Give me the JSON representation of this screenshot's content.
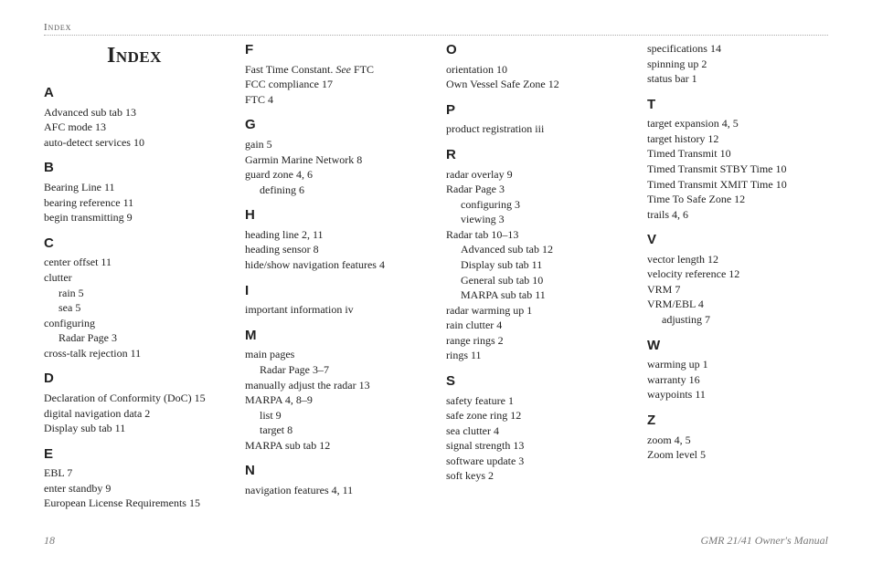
{
  "header_top": "Index",
  "title": "Index",
  "footer_left": "18",
  "footer_right": "GMR 21/41 Owner's Manual",
  "cols": [
    [
      {
        "type": "title"
      },
      {
        "type": "letter",
        "text": "A"
      },
      {
        "type": "entry",
        "text": "Advanced sub tab  13"
      },
      {
        "type": "entry",
        "text": "AFC mode  13"
      },
      {
        "type": "entry",
        "text": "auto-detect services  10"
      },
      {
        "type": "letter",
        "text": "B"
      },
      {
        "type": "entry",
        "text": "Bearing Line  11"
      },
      {
        "type": "entry",
        "text": "bearing reference  11"
      },
      {
        "type": "entry",
        "text": "begin transmitting  9"
      },
      {
        "type": "letter",
        "text": "C"
      },
      {
        "type": "entry",
        "text": "center offset  11"
      },
      {
        "type": "entry",
        "text": "clutter"
      },
      {
        "type": "sub",
        "text": "rain  5"
      },
      {
        "type": "sub",
        "text": "sea  5"
      },
      {
        "type": "entry",
        "text": "configuring"
      },
      {
        "type": "sub",
        "text": "Radar Page  3"
      },
      {
        "type": "entry",
        "text": "cross-talk rejection  11"
      },
      {
        "type": "letter",
        "text": "D"
      },
      {
        "type": "entry",
        "text": "Declaration of Conformity (DoC)  15"
      },
      {
        "type": "entry",
        "text": "digital navigation data  2"
      },
      {
        "type": "entry",
        "text": "Display sub tab  11"
      },
      {
        "type": "letter",
        "text": "E"
      },
      {
        "type": "entry",
        "text": "EBL  7"
      },
      {
        "type": "entry",
        "text": "enter standby  9"
      },
      {
        "type": "entry",
        "text": "European License Requirements  15"
      }
    ],
    [
      {
        "type": "letter",
        "text": "F",
        "first": true
      },
      {
        "type": "entry",
        "text": "Fast Time Constant. ",
        "see": "See",
        "after": " FTC"
      },
      {
        "type": "entry",
        "text": "FCC compliance  17"
      },
      {
        "type": "entry",
        "text": "FTC  4"
      },
      {
        "type": "letter",
        "text": "G"
      },
      {
        "type": "entry",
        "text": "gain  5"
      },
      {
        "type": "entry",
        "text": "Garmin Marine Network  8"
      },
      {
        "type": "entry",
        "text": "guard zone  4, 6"
      },
      {
        "type": "sub",
        "text": "defining  6"
      },
      {
        "type": "letter",
        "text": "H"
      },
      {
        "type": "entry",
        "text": "heading line  2, 11"
      },
      {
        "type": "entry",
        "text": "heading sensor  8"
      },
      {
        "type": "entry",
        "text": "hide/show navigation features  4"
      },
      {
        "type": "letter",
        "text": "I"
      },
      {
        "type": "entry",
        "text": "important information  iv"
      },
      {
        "type": "letter",
        "text": "M"
      },
      {
        "type": "entry",
        "text": "main pages"
      },
      {
        "type": "sub",
        "text": "Radar Page  3–7"
      },
      {
        "type": "entry",
        "text": "manually adjust the radar  13"
      },
      {
        "type": "entry",
        "text": "MARPA  4, 8–9"
      },
      {
        "type": "sub",
        "text": "list  9"
      },
      {
        "type": "sub",
        "text": "target  8"
      },
      {
        "type": "entry",
        "text": "MARPA sub tab  12"
      },
      {
        "type": "letter",
        "text": "N"
      },
      {
        "type": "entry",
        "text": "navigation features  4, 11"
      }
    ],
    [
      {
        "type": "letter",
        "text": "O",
        "first": true
      },
      {
        "type": "entry",
        "text": "orientation  10"
      },
      {
        "type": "entry",
        "text": "Own Vessel Safe Zone  12"
      },
      {
        "type": "letter",
        "text": "P"
      },
      {
        "type": "entry",
        "text": "product registration  iii"
      },
      {
        "type": "letter",
        "text": "R"
      },
      {
        "type": "entry",
        "text": "radar overlay  9"
      },
      {
        "type": "entry",
        "text": "Radar Page  3"
      },
      {
        "type": "sub",
        "text": "configuring  3"
      },
      {
        "type": "sub",
        "text": "viewing  3"
      },
      {
        "type": "entry",
        "text": "Radar tab  10–13"
      },
      {
        "type": "sub",
        "text": "Advanced sub tab  12"
      },
      {
        "type": "sub",
        "text": "Display sub tab  11"
      },
      {
        "type": "sub",
        "text": "General sub tab  10"
      },
      {
        "type": "sub",
        "text": "MARPA sub tab  11"
      },
      {
        "type": "entry",
        "text": "radar warming up  1"
      },
      {
        "type": "entry",
        "text": "rain clutter  4"
      },
      {
        "type": "entry",
        "text": "range rings  2"
      },
      {
        "type": "entry",
        "text": "rings  11"
      },
      {
        "type": "letter",
        "text": "S"
      },
      {
        "type": "entry",
        "text": "safety feature  1"
      },
      {
        "type": "entry",
        "text": "safe zone ring  12"
      },
      {
        "type": "entry",
        "text": "sea clutter  4"
      },
      {
        "type": "entry",
        "text": "signal strength  13"
      },
      {
        "type": "entry",
        "text": "software update  3"
      },
      {
        "type": "entry",
        "text": "soft keys  2"
      }
    ],
    [
      {
        "type": "entry",
        "text": "specifications  14"
      },
      {
        "type": "entry",
        "text": "spinning up  2"
      },
      {
        "type": "entry",
        "text": "status bar  1"
      },
      {
        "type": "letter",
        "text": "T"
      },
      {
        "type": "entry",
        "text": "target expansion  4, 5"
      },
      {
        "type": "entry",
        "text": "target history  12"
      },
      {
        "type": "entry",
        "text": "Timed Transmit  10"
      },
      {
        "type": "entry",
        "text": "Timed Transmit STBY Time  10"
      },
      {
        "type": "entry",
        "text": "Timed Transmit XMIT Time  10"
      },
      {
        "type": "entry",
        "text": "Time To Safe Zone  12"
      },
      {
        "type": "entry",
        "text": "trails  4, 6"
      },
      {
        "type": "letter",
        "text": "V"
      },
      {
        "type": "entry",
        "text": "vector length  12"
      },
      {
        "type": "entry",
        "text": "velocity reference  12"
      },
      {
        "type": "entry",
        "text": "VRM  7"
      },
      {
        "type": "entry",
        "text": "VRM/EBL  4"
      },
      {
        "type": "sub",
        "text": "adjusting  7"
      },
      {
        "type": "letter",
        "text": "W"
      },
      {
        "type": "entry",
        "text": "warming up  1"
      },
      {
        "type": "entry",
        "text": "warranty  16"
      },
      {
        "type": "entry",
        "text": "waypoints  11"
      },
      {
        "type": "letter",
        "text": "Z"
      },
      {
        "type": "entry",
        "text": "zoom  4, 5"
      },
      {
        "type": "entry",
        "text": "Zoom level  5"
      }
    ]
  ]
}
